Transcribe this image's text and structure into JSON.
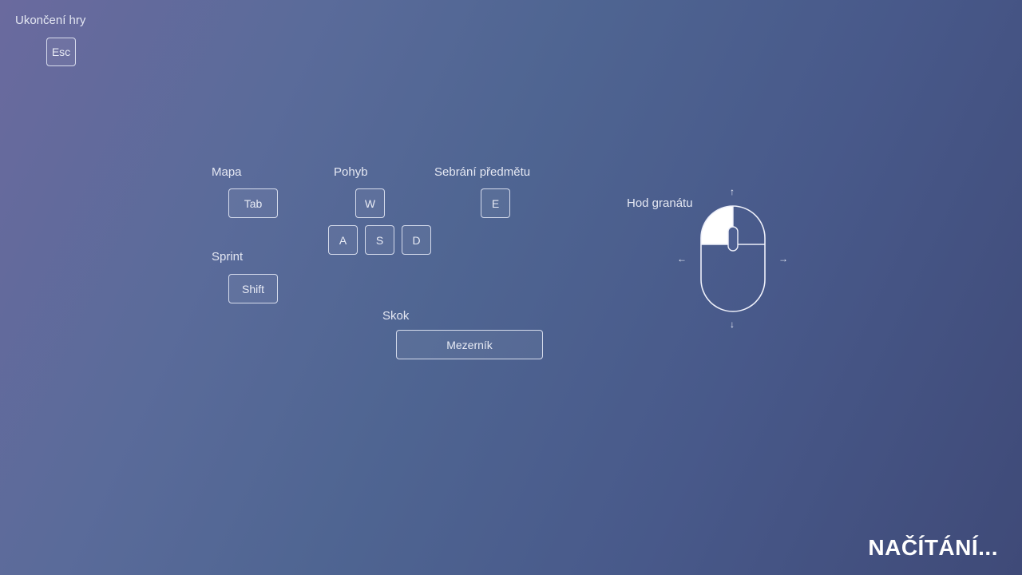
{
  "quit": {
    "label": "Ukončení hry",
    "key": "Esc"
  },
  "map": {
    "label": "Mapa",
    "key": "Tab"
  },
  "move": {
    "label": "Pohyb",
    "keys": [
      "W",
      "A",
      "S",
      "D"
    ]
  },
  "pickup": {
    "label": "Sebrání předmětu",
    "key": "E"
  },
  "sprint": {
    "label": "Sprint",
    "key": "Shift"
  },
  "jump": {
    "label": "Skok",
    "key": "Mezerník"
  },
  "grenade": {
    "label": "Hod granátu",
    "icon": "mouse-left-button-icon"
  },
  "arrows": {
    "up": "↑",
    "down": "↓",
    "left": "←",
    "right": "→"
  },
  "loading": {
    "text": "NAČÍTÁNÍ..."
  }
}
